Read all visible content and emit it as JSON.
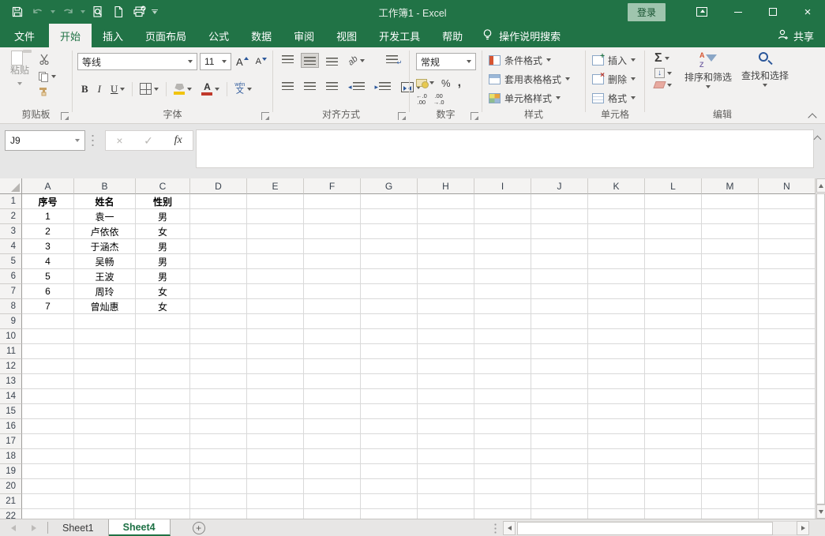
{
  "titlebar": {
    "title": "工作簿1 - Excel",
    "login": "登录"
  },
  "tabs": {
    "file": "文件",
    "items": [
      {
        "label": "开始"
      },
      {
        "label": "插入"
      },
      {
        "label": "页面布局"
      },
      {
        "label": "公式"
      },
      {
        "label": "数据"
      },
      {
        "label": "审阅"
      },
      {
        "label": "视图"
      },
      {
        "label": "开发工具"
      },
      {
        "label": "帮助"
      }
    ],
    "active": "开始",
    "tell_me": "操作说明搜索",
    "share": "共享"
  },
  "ribbon": {
    "clipboard": {
      "label": "剪贴板",
      "paste": "粘贴"
    },
    "font": {
      "label": "字体",
      "family": "等线",
      "size": "11",
      "bold": "B",
      "italic": "I",
      "underline": "U",
      "phonetic_top": "wén",
      "phonetic_bottom": "文",
      "fill_color": "#f1c40f",
      "font_color": "#c0392b"
    },
    "alignment": {
      "label": "对齐方式"
    },
    "number": {
      "label": "数字",
      "format": "常规",
      "percent": "%",
      "comma": ",",
      "inc_decimal": "←.0\n.00",
      "dec_decimal": ".00\n→.0"
    },
    "styles": {
      "label": "样式",
      "conditional": "条件格式",
      "format_as_table": "套用表格格式",
      "cell_styles": "单元格样式"
    },
    "cells": {
      "label": "单元格",
      "insert": "插入",
      "delete": "删除",
      "format": "格式"
    },
    "editing": {
      "label": "编辑",
      "autosum": "Σ",
      "fill_arrow": "↓",
      "sort_filter": "排序和筛选",
      "find_select": "查找和选择"
    }
  },
  "formula_bar": {
    "name_box": "J9",
    "cancel": "×",
    "enter": "✓",
    "fx": "fx",
    "value": ""
  },
  "grid": {
    "columns": [
      "A",
      "B",
      "C",
      "D",
      "E",
      "F",
      "G",
      "H",
      "I",
      "J",
      "K",
      "L",
      "M",
      "N"
    ],
    "visible_rows": 22,
    "table": {
      "headers": [
        "序号",
        "姓名",
        "性别"
      ],
      "rows": [
        [
          "1",
          "袁一",
          "男"
        ],
        [
          "2",
          "卢依依",
          "女"
        ],
        [
          "3",
          "于涵杰",
          "男"
        ],
        [
          "4",
          "吴畅",
          "男"
        ],
        [
          "5",
          "王波",
          "男"
        ],
        [
          "6",
          "周玲",
          "女"
        ],
        [
          "7",
          "曾灿惠",
          "女"
        ]
      ]
    }
  },
  "sheet_bar": {
    "tabs": [
      {
        "label": "Sheet1",
        "active": false
      },
      {
        "label": "Sheet4",
        "active": true
      }
    ],
    "add_label": "+"
  },
  "colors": {
    "accent_green": "#217346"
  }
}
